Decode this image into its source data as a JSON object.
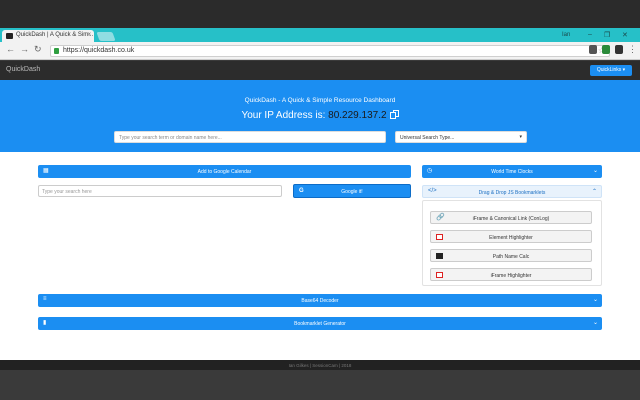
{
  "browser": {
    "tab_title": "QuickDash | A Quick & Sim...",
    "tab_close": "×",
    "url": "https://quickdash.co.uk",
    "user": "Ian",
    "min": "–",
    "restore": "❐",
    "close": "✕",
    "back": "←",
    "forward": "→",
    "reload": "↻",
    "star": "☆",
    "menu": "⋮"
  },
  "app": {
    "brand": "QuickDash",
    "quicklinks_label": "QuickLinks ▾"
  },
  "hero": {
    "title": "QuickDash - A Quick & Simple Resource Dashboard",
    "ip_label": "Your IP Address is: ",
    "ip_value": "80.229.137.2",
    "search_placeholder": "Type your search term or domain name here...",
    "select_value": "Universal Search Type...",
    "select_caret": "▾"
  },
  "panels": {
    "calendar": {
      "label": "Add to Google Calendar",
      "icon": "calendar-icon",
      "glyph": "▦"
    },
    "world_time": {
      "label": "World Time Clocks",
      "icon": "clock-icon",
      "glyph": "◷",
      "chev": "⌄"
    },
    "bookmarklets": {
      "label": "Drag & Drop JS Bookmarklets",
      "icon": "code-icon",
      "glyph": "</>",
      "chev": "⌃"
    },
    "base64": {
      "label": "Base64 Decoder",
      "icon": "db-icon",
      "glyph": "≡",
      "chev": "⌄"
    },
    "bm_gen": {
      "label": "Bookmarklet Generator",
      "icon": "bookmark-icon",
      "glyph": "▮",
      "chev": "⌄"
    }
  },
  "google": {
    "placeholder": "Type your search here",
    "button": "Google it!",
    "g": "G"
  },
  "bookmarklets": [
    {
      "label": "iFrame & Canonical Link (ConLog)",
      "icon": "link-icon"
    },
    {
      "label": "Element Highlighter",
      "icon": "square-icon"
    },
    {
      "label": "Path Name Calc",
      "icon": "save-icon"
    },
    {
      "label": "iFrame Highlighter",
      "icon": "square-icon"
    }
  ],
  "footer": {
    "text": "Ian Gilkes | SessionCam | 2018"
  },
  "colors": {
    "accent": "#1b8ef2",
    "tabbar": "#26c0c8",
    "dark": "#2c2c2c"
  }
}
